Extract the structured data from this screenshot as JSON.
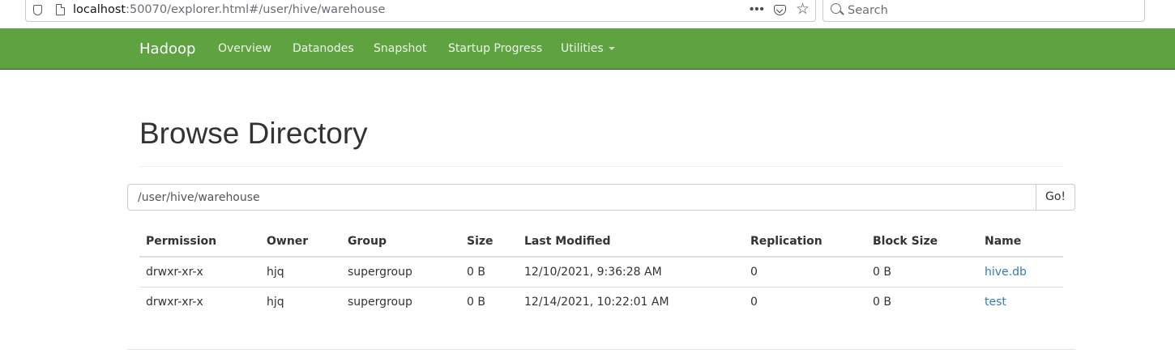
{
  "browser": {
    "url_host": "localhost",
    "url_rest": ":50070/explorer.html#/user/hive/warehouse",
    "menu_dots": "•••",
    "star_glyph": "☆",
    "search_placeholder": "Search"
  },
  "navbar": {
    "brand": "Hadoop",
    "items": [
      {
        "label": "Overview"
      },
      {
        "label": "Datanodes"
      },
      {
        "label": "Snapshot"
      },
      {
        "label": "Startup Progress"
      },
      {
        "label": "Utilities",
        "dropdown": true
      }
    ],
    "background_color": "#5fa341"
  },
  "main": {
    "title": "Browse Directory",
    "path_value": "/user/hive/warehouse",
    "go_label": "Go!",
    "table": {
      "headers": [
        "Permission",
        "Owner",
        "Group",
        "Size",
        "Last Modified",
        "Replication",
        "Block Size",
        "Name"
      ],
      "rows": [
        {
          "permission": "drwxr-xr-x",
          "owner": "hjq",
          "group": "supergroup",
          "size": "0 B",
          "last_modified": "12/10/2021, 9:36:28 AM",
          "replication": "0",
          "block_size": "0 B",
          "name": "hive.db"
        },
        {
          "permission": "drwxr-xr-x",
          "owner": "hjq",
          "group": "supergroup",
          "size": "0 B",
          "last_modified": "12/14/2021, 10:22:01 AM",
          "replication": "0",
          "block_size": "0 B",
          "name": "test"
        }
      ]
    },
    "link_color": "#337ab7"
  }
}
